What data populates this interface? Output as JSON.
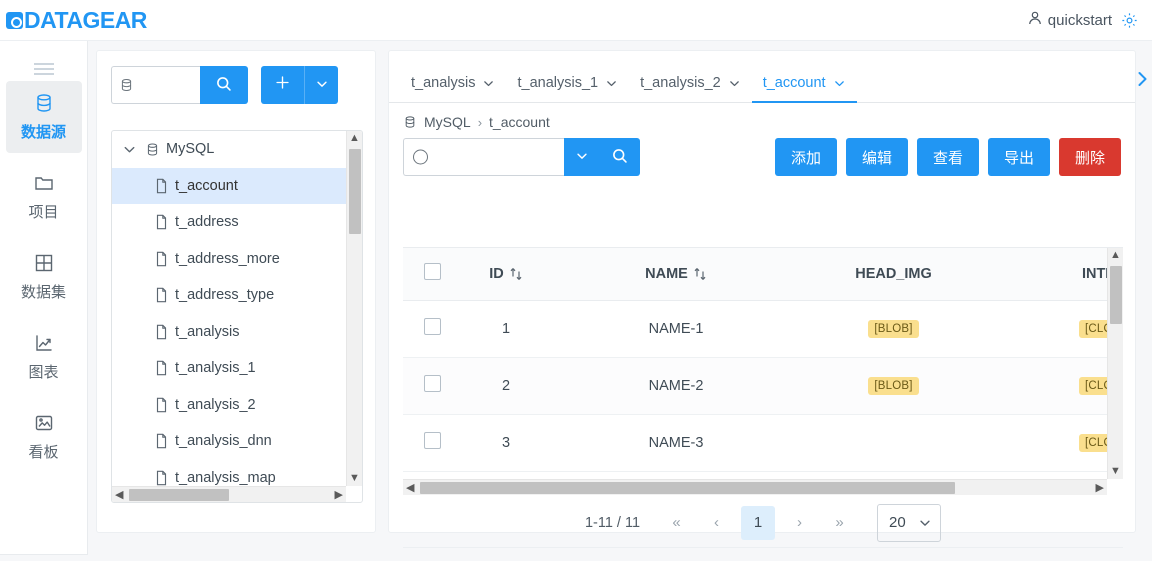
{
  "app": {
    "logo_text": "DATAGEAR",
    "user_name": "quickstart"
  },
  "rail": {
    "items": [
      {
        "label": "数据源",
        "icon": "database-icon",
        "active": true
      },
      {
        "label": "项目",
        "icon": "folder-icon",
        "active": false
      },
      {
        "label": "数据集",
        "icon": "grid-icon",
        "active": false
      },
      {
        "label": "图表",
        "icon": "chart-icon",
        "active": false
      },
      {
        "label": "看板",
        "icon": "dashboard-icon",
        "active": false
      }
    ]
  },
  "datasource_panel": {
    "search_value": "",
    "search_placeholder": "",
    "search_icon": "database-icon",
    "search_button_icon": "search-icon",
    "add_button_icon": "plus-icon",
    "add_dropdown_icon": "chevron-down-icon",
    "tree": {
      "root": {
        "label": "MySQL",
        "icon": "database-icon",
        "expanded": true
      },
      "children": [
        {
          "label": "t_account",
          "selected": true
        },
        {
          "label": "t_address",
          "selected": false
        },
        {
          "label": "t_address_more",
          "selected": false
        },
        {
          "label": "t_address_type",
          "selected": false
        },
        {
          "label": "t_analysis",
          "selected": false
        },
        {
          "label": "t_analysis_1",
          "selected": false
        },
        {
          "label": "t_analysis_2",
          "selected": false
        },
        {
          "label": "t_analysis_dnn",
          "selected": false
        },
        {
          "label": "t_analysis_map",
          "selected": false
        }
      ]
    }
  },
  "main": {
    "tabs": [
      {
        "label": "t_analysis",
        "active": false
      },
      {
        "label": "t_analysis_1",
        "active": false
      },
      {
        "label": "t_analysis_2",
        "active": false
      },
      {
        "label": "t_account",
        "active": true
      }
    ],
    "tab_next_icon": "chevron-right-icon",
    "breadcrumb": {
      "root": "MySQL",
      "separator": "›",
      "current": "t_account"
    },
    "search": {
      "value": "",
      "placeholder": "",
      "dropdown_icon": "chevron-down-icon",
      "submit_icon": "search-icon"
    },
    "actions": [
      {
        "label": "添加",
        "style": "primary"
      },
      {
        "label": "编辑",
        "style": "primary"
      },
      {
        "label": "查看",
        "style": "primary"
      },
      {
        "label": "导出",
        "style": "primary"
      },
      {
        "label": "删除",
        "style": "danger"
      }
    ],
    "table": {
      "columns": [
        {
          "label": "",
          "type": "checkbox",
          "sortable": false
        },
        {
          "label": "ID",
          "type": "text",
          "sortable": true
        },
        {
          "label": "NAME",
          "type": "text",
          "sortable": true
        },
        {
          "label": "HEAD_IMG",
          "type": "text",
          "sortable": false
        },
        {
          "label": "INTRO",
          "type": "text",
          "sortable": false
        }
      ],
      "rows": [
        {
          "id": "1",
          "name": "NAME-1",
          "head_img": "[BLOB]",
          "intro": "[CLOB]"
        },
        {
          "id": "2",
          "name": "NAME-2",
          "head_img": "[BLOB]",
          "intro": "[CLOB]"
        },
        {
          "id": "3",
          "name": "NAME-3",
          "head_img": "",
          "intro": "[CLOB]"
        }
      ]
    },
    "pagination": {
      "info": "1-11 / 11",
      "first_icon": "«",
      "prev_icon": "‹",
      "current_page": "1",
      "next_icon": "›",
      "last_icon": "»",
      "page_size": "20"
    }
  },
  "colors": {
    "brand_blue": "#2196f3",
    "danger_red": "#d9392f",
    "badge_yellow": "#fadf8e",
    "active_tab_blue": "#2196f3",
    "selected_row_blue": "#dbeafd"
  }
}
